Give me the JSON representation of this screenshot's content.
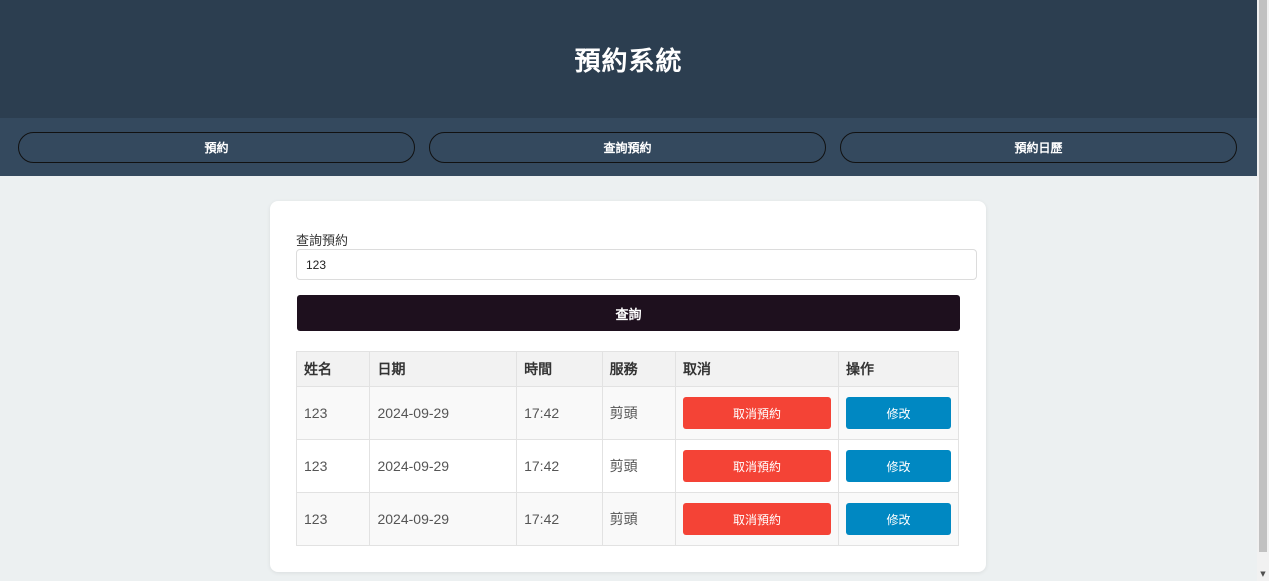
{
  "header": {
    "title": "預約系統"
  },
  "nav": {
    "items": [
      {
        "label": "預約"
      },
      {
        "label": "查詢預約"
      },
      {
        "label": "預約日歷"
      }
    ]
  },
  "search": {
    "label": "查詢預約",
    "value": "123",
    "button_label": "查詢"
  },
  "table": {
    "headers": [
      "姓名",
      "日期",
      "時間",
      "服務",
      "取消",
      "操作"
    ],
    "rows": [
      {
        "name": "123",
        "date": "2024-09-29",
        "time": "17:42",
        "service": "剪頭",
        "cancel_label": "取消預約",
        "edit_label": "修改"
      },
      {
        "name": "123",
        "date": "2024-09-29",
        "time": "17:42",
        "service": "剪頭",
        "cancel_label": "取消預約",
        "edit_label": "修改"
      },
      {
        "name": "123",
        "date": "2024-09-29",
        "time": "17:42",
        "service": "剪頭",
        "cancel_label": "取消預約",
        "edit_label": "修改"
      }
    ]
  },
  "colors": {
    "header_bg": "#2c3e50",
    "nav_bg": "#34495e",
    "page_bg": "#ecf0f1",
    "search_button": "#1e101e",
    "cancel_button": "#f44336",
    "edit_button": "#0088c2"
  },
  "icons": {
    "scroll_down": "scroll-down-arrow-icon"
  }
}
